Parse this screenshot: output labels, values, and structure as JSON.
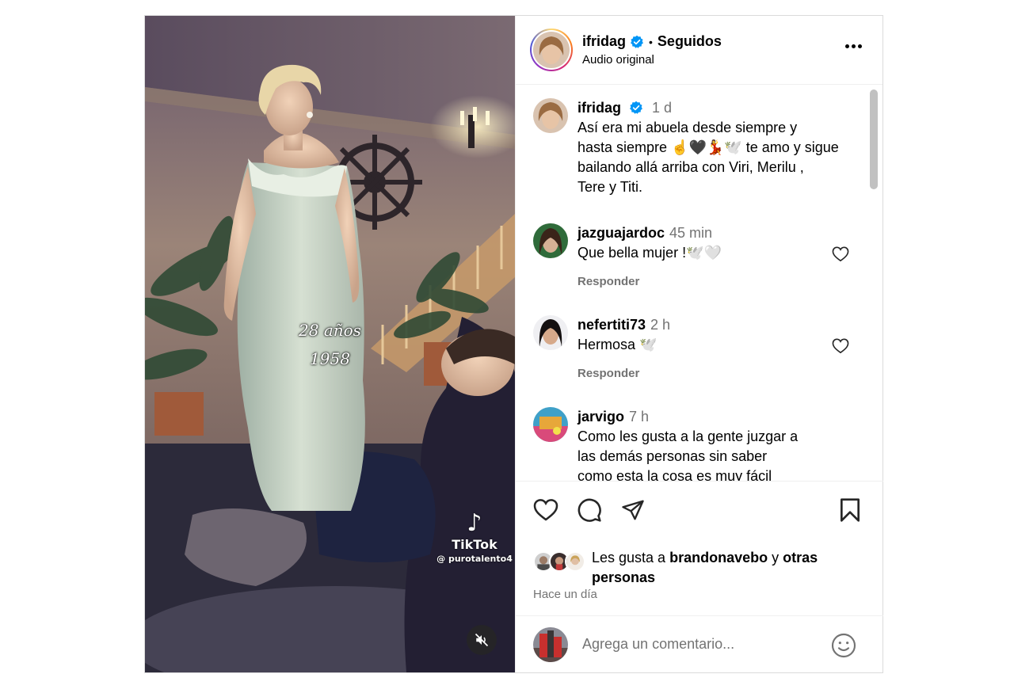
{
  "post": {
    "author": "ifridag",
    "follow_state": "Seguidos",
    "separator": "•",
    "audio": "Audio original"
  },
  "media": {
    "overlay_line1": "28 años",
    "overlay_line2": "1958",
    "watermark_brand": "TikTok",
    "watermark_handle": "@ purotalento4",
    "muted": true
  },
  "caption": {
    "user": "ifridag",
    "time": "1 d",
    "text_lines": [
      "Así era mi abuela desde siempre y",
      "hasta siempre ☝️🖤💃🕊️ te amo y sigue",
      "bailando allá arriba con Viri, Merilu ,",
      "Tere y Titi."
    ]
  },
  "comments": [
    {
      "user": "jazguajardoc",
      "time": "45 min",
      "text": "Que bella mujer !🕊️🤍",
      "reply": "Responder"
    },
    {
      "user": "nefertiti73",
      "time": "2 h",
      "text": "Hermosa 🕊️",
      "reply": "Responder"
    },
    {
      "user": "jarvigo",
      "time": "7 h",
      "text_lines": [
        "Como les gusta a la gente juzgar a",
        "las demás personas sin saber",
        "como esta la cosa es muy fácil"
      ]
    }
  ],
  "likes": {
    "prefix": "Les gusta a",
    "user": "brandonavebo",
    "connector": "y",
    "rest": "otras personas"
  },
  "time_ago": "Hace un día",
  "composer": {
    "placeholder": "Agrega un comentario..."
  },
  "colors": {
    "verified": "#0095f6",
    "muted_text": "#737373",
    "border": "#dbdbdb"
  }
}
